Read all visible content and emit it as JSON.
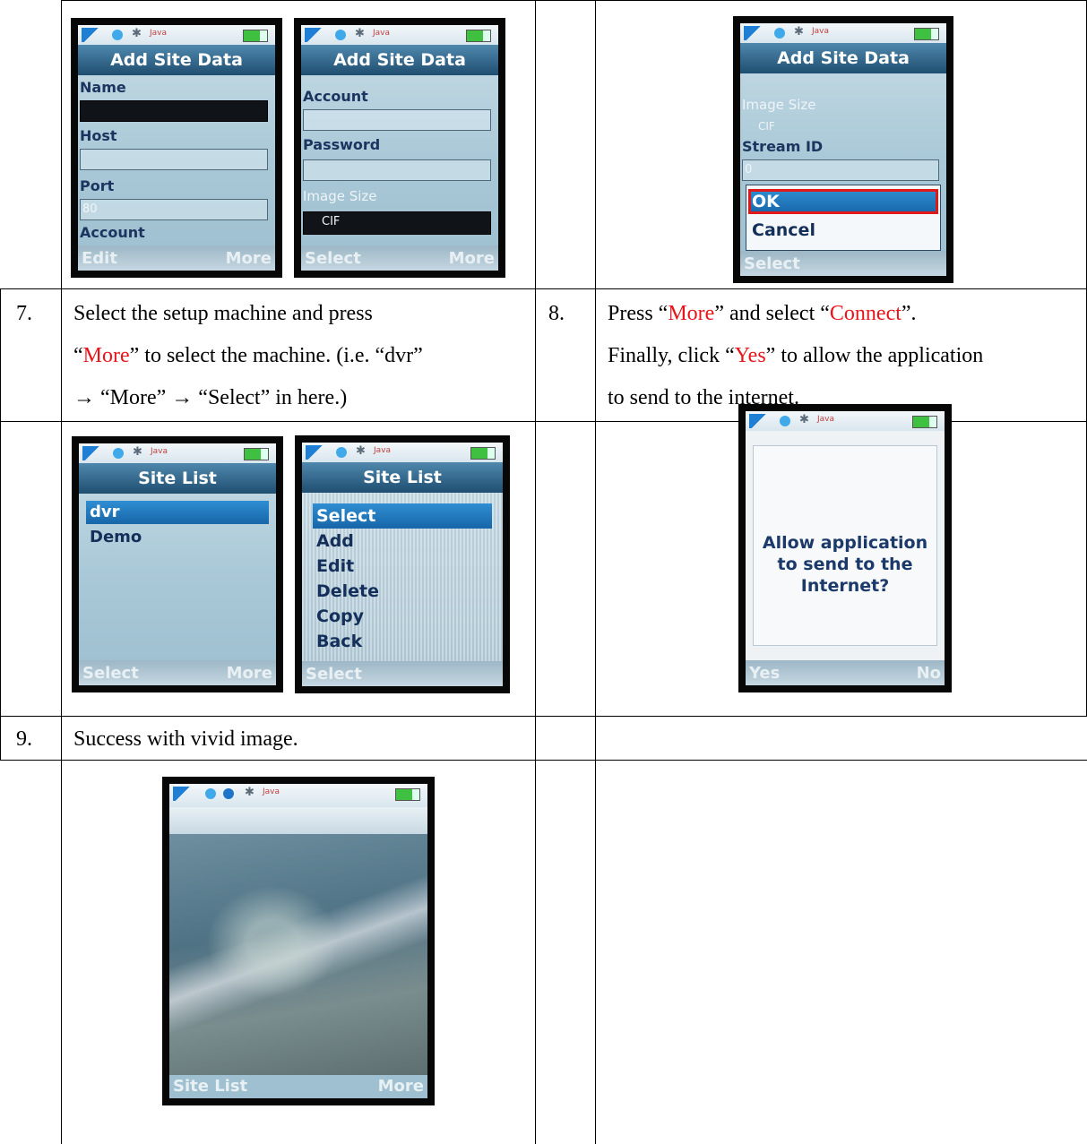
{
  "screens": {
    "add_site_1": {
      "title": "Add Site Data",
      "labels": [
        "Name",
        "Host",
        "Port",
        "Account"
      ],
      "port_value": "80",
      "softkey_left": "Edit",
      "softkey_right": "More"
    },
    "add_site_2": {
      "title": "Add Site Data",
      "labels": [
        "Account",
        "Password",
        "Image Size"
      ],
      "image_size_value": "CIF",
      "softkey_left": "Select",
      "softkey_right": "More"
    },
    "add_site_3": {
      "title": "Add Site Data",
      "labels": [
        "Image Size",
        "Stream ID"
      ],
      "image_size_value": "CIF",
      "stream_value": "0",
      "popup_items": [
        "OK",
        "Cancel"
      ],
      "softkey_left": "Select"
    },
    "site_list_1": {
      "title": "Site List",
      "items": [
        "dvr",
        "Demo"
      ],
      "softkey_left": "Select",
      "softkey_right": "More"
    },
    "site_list_2": {
      "title": "Site List",
      "menu": [
        "Select",
        "Add",
        "Edit",
        "Delete",
        "Copy",
        "Back"
      ],
      "softkey_left": "Select"
    },
    "allow": {
      "message_lines": [
        "Allow application",
        "to send to the",
        "Internet?"
      ],
      "softkey_left": "Yes",
      "softkey_right": "No"
    },
    "live": {
      "softkey_left": "Site List",
      "softkey_right": "More"
    },
    "status_java": "Java"
  },
  "steps": {
    "s7": {
      "num": "7.",
      "line1": "Select the setup machine and press",
      "line2_q1": "“",
      "line2_red": "More",
      "line2_rest": "” to select the machine. (i.e. “dvr”",
      "line3": "→ “More” → “Select” in here.)"
    },
    "s8": {
      "num": "8.",
      "line1_a": "Press “",
      "line1_red1": "More",
      "line1_b": "” and select “",
      "line1_red2": "Connect",
      "line1_c": "”.",
      "line2_a": "Finally, click “",
      "line2_red": "Yes",
      "line2_b": "” to allow the application",
      "line3": "to send to the internet."
    },
    "s9": {
      "num": "9.",
      "text": "Success with vivid image."
    }
  }
}
